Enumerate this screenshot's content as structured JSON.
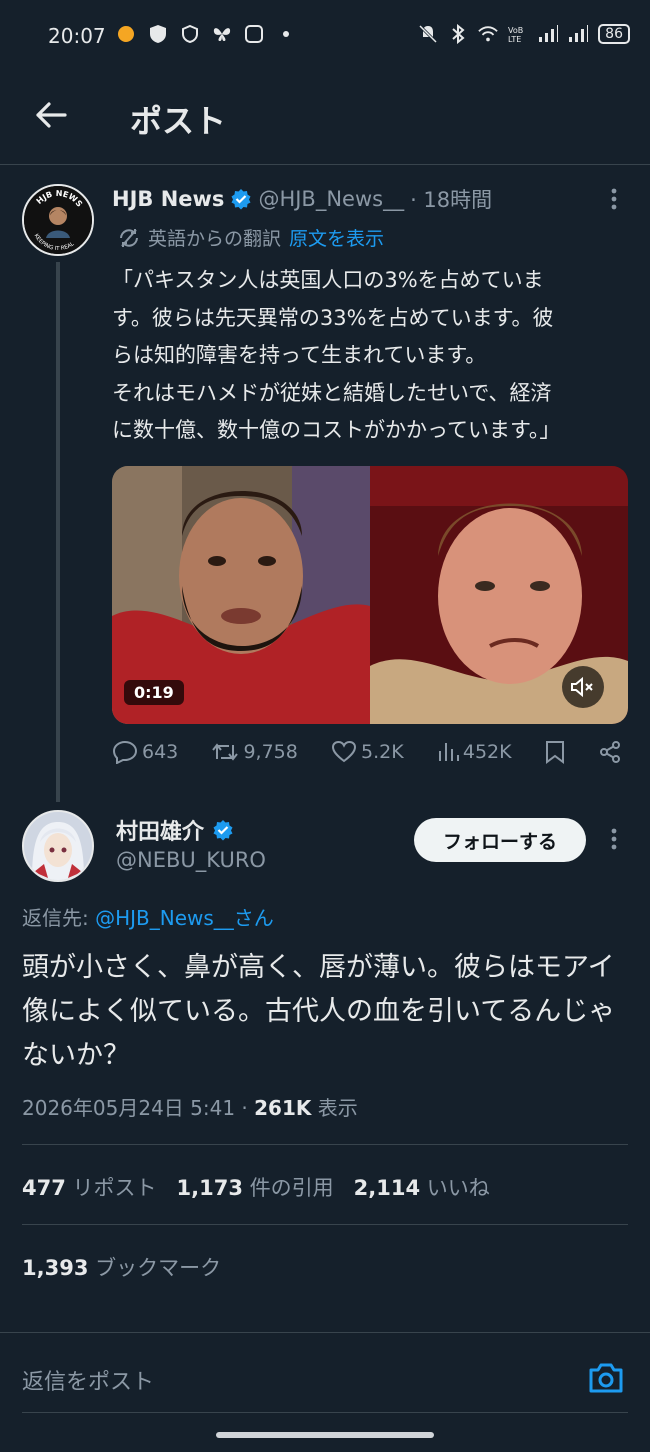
{
  "status_bar": {
    "time": "20:07",
    "battery": "86"
  },
  "header": {
    "title": "ポスト"
  },
  "tweet": {
    "name": "HJB News",
    "handle": "@HJB_News__",
    "time": "· 18時間",
    "translated_label": "英語からの翻訳",
    "show_original": "原文を表示",
    "text": "「パキスタン人は英国人口の3%を占めていま\nす。彼らは先天異常の33%を占めています。彼\nらは知的障害を持って生まれています。\nそれはモハメドが従妹と結婚したせいで、経済\nに数十億、数十億のコストがかかっています。」",
    "video_time": "0:19",
    "avatar_text_top": "HJB NEWS",
    "avatar_text_bottom": "KEEPING IT REAL",
    "replies": "643",
    "reposts": "9,758",
    "likes": "5.2K",
    "views": "452K"
  },
  "reply": {
    "name": "村田雄介",
    "handle": "@NEBU_KURO",
    "follow_label": "フォローする",
    "reply_to_prefix": "返信先:",
    "reply_to_handle": "@HJB_News__さん",
    "text": "頭が小さく、鼻が高く、唇が薄い。彼らはモアイ像によく似ている。古代人の血を引いてるんじゃないか？",
    "date": "2026年05月24日 5:41 · ",
    "views_count": "261K",
    "views_label": " 表示"
  },
  "stats": {
    "reposts_count": "477",
    "reposts_label": "リポスト",
    "quotes_count": "1,173",
    "quotes_label": "件の引用",
    "likes_count": "2,114",
    "likes_label": "いいね",
    "bookmarks_count": "1,393",
    "bookmarks_label": "ブックマーク"
  },
  "compose": {
    "placeholder": "返信をポスト"
  },
  "colors": {
    "background": "#15202b",
    "accent": "#1d9bf0",
    "muted": "#8b98a5",
    "text": "#e7e9ea"
  }
}
